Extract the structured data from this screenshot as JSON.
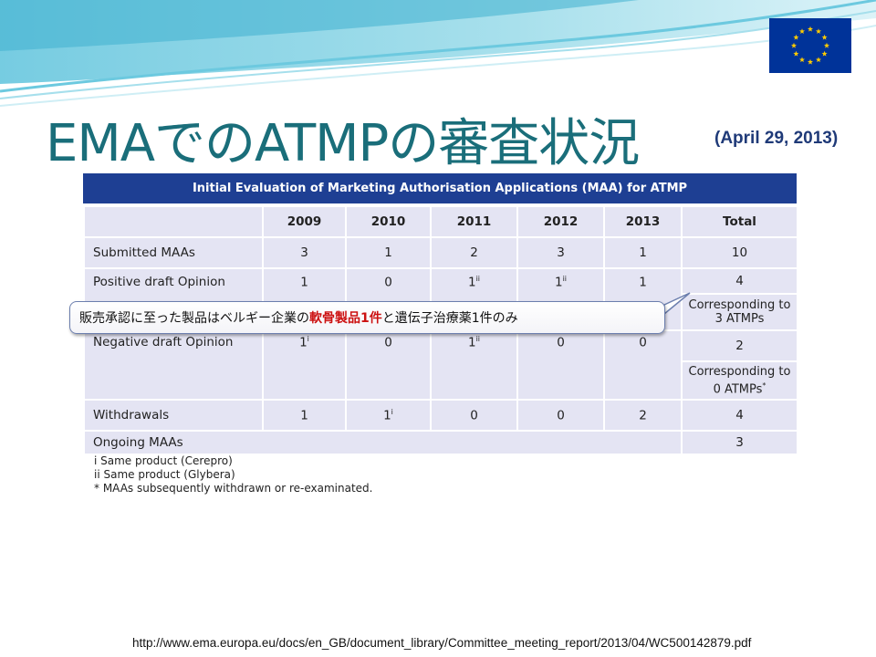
{
  "slide": {
    "title": "EMAでのATMPの審査状況",
    "date": "(April 29, 2013)",
    "source_url": "http://www.ema.europa.eu/docs/en_GB/document_library/Committee_meeting_report/2013/04/WC500142879.pdf"
  },
  "table": {
    "header": "Initial Evaluation of Marketing Authorisation Applications (MAA) for ATMP",
    "columns": [
      "",
      "2009",
      "2010",
      "2011",
      "2012",
      "2013",
      "Total"
    ],
    "rows": {
      "submitted": {
        "label": "Submitted MAAs",
        "values": [
          "3",
          "1",
          "2",
          "3",
          "1"
        ],
        "total": "10"
      },
      "positive": {
        "label": "Positive draft Opinion",
        "values": [
          "1",
          "0",
          "1",
          "1",
          "1"
        ],
        "sups": [
          "",
          "",
          "ii",
          "ii",
          ""
        ],
        "total": "4",
        "note": "Corresponding to 3 ATMPs"
      },
      "negative": {
        "label": "Negative draft Opinion",
        "values": [
          "1",
          "0",
          "1",
          "0",
          "0"
        ],
        "sups": [
          "i",
          "",
          "ii",
          "",
          ""
        ],
        "total": "2",
        "note": "Corresponding to 0 ATMPs",
        "note_sup": "*"
      },
      "withdrawals": {
        "label": "Withdrawals",
        "values": [
          "1",
          "1",
          "0",
          "0",
          "2"
        ],
        "sups": [
          "",
          "i",
          "",
          "",
          ""
        ],
        "total": "4"
      },
      "ongoing": {
        "label": "Ongoing MAAs",
        "total": "3"
      }
    },
    "footnotes": [
      "i Same product (Cerepro)",
      "ii Same product (Glybera)",
      "* MAAs subsequently withdrawn or re-examinated."
    ]
  },
  "callout": {
    "text_before": "販売承認に至った製品はベルギー企業の",
    "highlight": "軟骨製品1件",
    "text_after": "と遺伝子治療薬1件のみ",
    "highlight_color": "#cc1111"
  },
  "colors": {
    "title": "#1a6e7a",
    "table_header_bg": "#1e3f93",
    "table_cell_bg": "#e4e4f3",
    "eu_blue": "#003399",
    "eu_gold": "#ffcc00"
  },
  "icons": [
    "eu-flag-icon"
  ]
}
